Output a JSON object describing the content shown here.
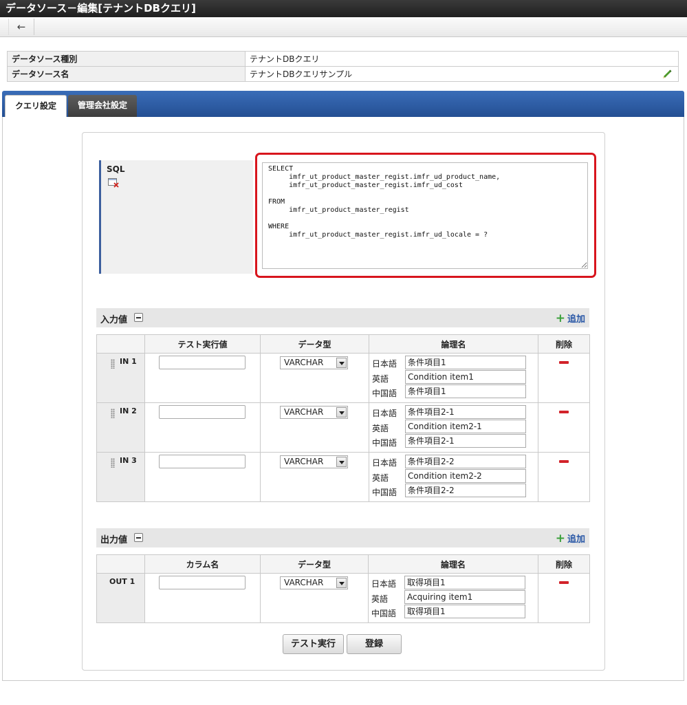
{
  "window": {
    "title": "データソース－編集[テナントDBクエリ]"
  },
  "toolbar": {
    "back_icon": "←"
  },
  "info": {
    "rows": [
      {
        "label": "データソース種別",
        "value": "テナントDBクエリ"
      },
      {
        "label": "データソース名",
        "value": "テナントDBクエリサンプル"
      }
    ]
  },
  "tabs": [
    {
      "label": "クエリ設定",
      "active": true
    },
    {
      "label": "管理会社設定",
      "active": false
    }
  ],
  "sql": {
    "label": "SQL",
    "text": "SELECT\n     imfr_ut_product_master_regist.imfr_ud_product_name,\n     imfr_ut_product_master_regist.imfr_ud_cost\n\nFROM\n     imfr_ut_product_master_regist\n\nWHERE\n     imfr_ut_product_master_regist.imfr_ud_locale = ?"
  },
  "inputs": {
    "title": "入力値",
    "add_label": "追加",
    "headers": [
      "",
      "テスト実行値",
      "データ型",
      "論理名",
      "削除"
    ],
    "rows": [
      {
        "id": "IN 1",
        "type": "VARCHAR",
        "names": [
          {
            "lang": "日本語",
            "value": "条件項目1"
          },
          {
            "lang": "英語",
            "value": "Condition item1"
          },
          {
            "lang": "中国語",
            "value": "条件項目1"
          }
        ]
      },
      {
        "id": "IN 2",
        "type": "VARCHAR",
        "names": [
          {
            "lang": "日本語",
            "value": "条件項目2-1"
          },
          {
            "lang": "英語",
            "value": "Condition item2-1"
          },
          {
            "lang": "中国語",
            "value": "条件項目2-1"
          }
        ]
      },
      {
        "id": "IN 3",
        "type": "VARCHAR",
        "names": [
          {
            "lang": "日本語",
            "value": "条件項目2-2"
          },
          {
            "lang": "英語",
            "value": "Condition item2-2"
          },
          {
            "lang": "中国語",
            "value": "条件項目2-2"
          }
        ]
      }
    ]
  },
  "outputs": {
    "title": "出力値",
    "add_label": "追加",
    "headers": [
      "",
      "カラム名",
      "データ型",
      "論理名",
      "削除"
    ],
    "rows": [
      {
        "id": "OUT 1",
        "type": "VARCHAR",
        "names": [
          {
            "lang": "日本語",
            "value": "取得項目1"
          },
          {
            "lang": "英語",
            "value": "Acquiring item1"
          },
          {
            "lang": "中国語",
            "value": "取得項目1"
          }
        ]
      }
    ]
  },
  "buttons": {
    "test_label": "テスト実行",
    "register_label": "登録"
  },
  "colors": {
    "accent": "#244f93",
    "highlight": "#d8151d",
    "delete": "#d2232a",
    "add": "#2a58a6"
  }
}
